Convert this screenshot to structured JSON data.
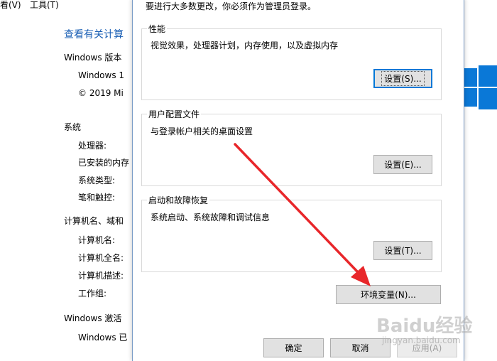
{
  "menu": {
    "view_label": "看(V)",
    "tools_label": "工具(T)"
  },
  "background": {
    "title": "查看有关计算",
    "windows_edition_label": "Windows 版本",
    "windows_name": "Windows 1",
    "copyright": "© 2019 Mi",
    "system_label": "系统",
    "processor_label": "处理器:",
    "memory_label": "已安装的内存",
    "system_type_label": "系统类型:",
    "pen_touch_label": "笔和触控:",
    "computer_name_section": "计算机名、域和",
    "computer_name_label": "计算机名:",
    "full_name_label": "计算机全名:",
    "description_label": "计算机描述:",
    "workgroup_label": "工作组:",
    "activation_label": "Windows 激活",
    "activated_text": "Windows 已"
  },
  "dialog": {
    "admin_note": "要进行大多数更改，你必须作为管理员登录。",
    "performance": {
      "title": "性能",
      "description": "视觉效果，处理器计划，内存使用，以及虚拟内存",
      "button_label": "设置(S)..."
    },
    "user_profiles": {
      "title": "用户配置文件",
      "description": "与登录帐户相关的桌面设置",
      "button_label": "设置(E)..."
    },
    "startup_recovery": {
      "title": "启动和故障恢复",
      "description": "系统启动、系统故障和调试信息",
      "button_label": "设置(T)..."
    },
    "env_vars_label": "环境变量(N)...",
    "ok_label": "确定",
    "cancel_label": "取消",
    "apply_label": "应用(A)"
  },
  "watermark": {
    "text": "Baidu经验",
    "url": "jingyan.baidu.com"
  },
  "colors": {
    "accent": "#0078d7",
    "annotation_arrow": "#e8262a",
    "windows_logo": "#0a78d7"
  },
  "icons": {
    "logo": "windows-logo-icon",
    "watermark": "baidu-paw-icon"
  }
}
